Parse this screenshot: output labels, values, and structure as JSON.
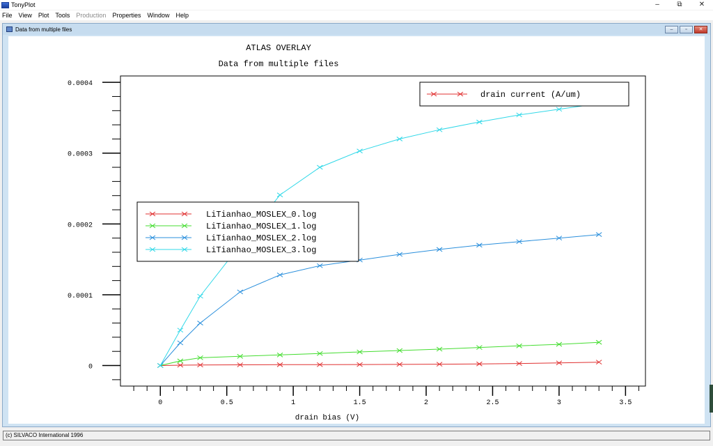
{
  "app": {
    "title": "TonyPlot"
  },
  "window_controls": {
    "minimize": "–",
    "restore": "⧉",
    "close": "✕"
  },
  "menu": [
    {
      "label": "File",
      "enabled": true
    },
    {
      "label": "View",
      "enabled": true
    },
    {
      "label": "Plot",
      "enabled": true
    },
    {
      "label": "Tools",
      "enabled": true
    },
    {
      "label": "Production",
      "enabled": false
    },
    {
      "label": "Properties",
      "enabled": true
    },
    {
      "label": "Window",
      "enabled": true
    },
    {
      "label": "Help",
      "enabled": true
    }
  ],
  "child_window": {
    "title": "Data from multiple files",
    "controls": {
      "minimize": "–",
      "restore": "▫",
      "close": "✕"
    }
  },
  "status": {
    "text": "(c) SILVACO International 1996"
  },
  "chart_data": {
    "type": "line",
    "title": "ATLAS OVERLAY",
    "subtitle": "Data from multiple files",
    "xlabel": "drain bias (V)",
    "ylabel": "",
    "xlim": [
      -0.3,
      3.65
    ],
    "ylim": [
      -2.9e-05,
      0.000409
    ],
    "x_ticks": [
      0,
      0.5,
      1,
      1.5,
      2,
      2.5,
      3,
      3.5
    ],
    "x_tick_labels": [
      "0",
      "0.5",
      "1",
      "1.5",
      "2",
      "2.5",
      "3",
      "3.5"
    ],
    "y_ticks": [
      0,
      0.0001,
      0.0002,
      0.0003,
      0.0004
    ],
    "y_tick_labels": [
      "0",
      "0.0001",
      "0.0002",
      "0.0003",
      "0.0004"
    ],
    "grid": false,
    "x": [
      0,
      0.15,
      0.3,
      0.6,
      0.9,
      1.2,
      1.5,
      1.8,
      2.1,
      2.4,
      2.7,
      3.0,
      3.3
    ],
    "series": [
      {
        "name": "LiTianhao_MOSLEX_0.log",
        "color": "#e03030",
        "values": [
          0,
          5e-07,
          8e-07,
          1e-06,
          1.2e-06,
          1.3e-06,
          1.4e-06,
          1.6e-06,
          1.9e-06,
          2.3e-06,
          2.9e-06,
          3.7e-06,
          4.8e-06
        ]
      },
      {
        "name": "LiTianhao_MOSLEX_1.log",
        "color": "#44dd30",
        "values": [
          0,
          6.5e-06,
          1.1e-05,
          1.3e-05,
          1.5e-05,
          1.7e-05,
          1.92e-05,
          2.12e-05,
          2.32e-05,
          2.55e-05,
          2.78e-05,
          3e-05,
          3.28e-05
        ]
      },
      {
        "name": "LiTianhao_MOSLEX_2.log",
        "color": "#2a8fdc",
        "values": [
          0,
          3.2e-05,
          6e-05,
          0.000104,
          0.000128,
          0.000141,
          0.000149,
          0.000157,
          0.000164,
          0.00017,
          0.000175,
          0.00018,
          0.000185
        ]
      },
      {
        "name": "LiTianhao_MOSLEX_3.log",
        "color": "#30d8e8",
        "values": [
          0,
          5e-05,
          9.8e-05,
          0.00017,
          0.000241,
          0.00028,
          0.000303,
          0.00032,
          0.000333,
          0.000344,
          0.000354,
          0.000362,
          0.00037
        ]
      }
    ],
    "quantity_legend": {
      "label": "drain current (A/um)",
      "color": "#e03030",
      "position": "top-right"
    },
    "legend": {
      "position": "center-left"
    }
  }
}
